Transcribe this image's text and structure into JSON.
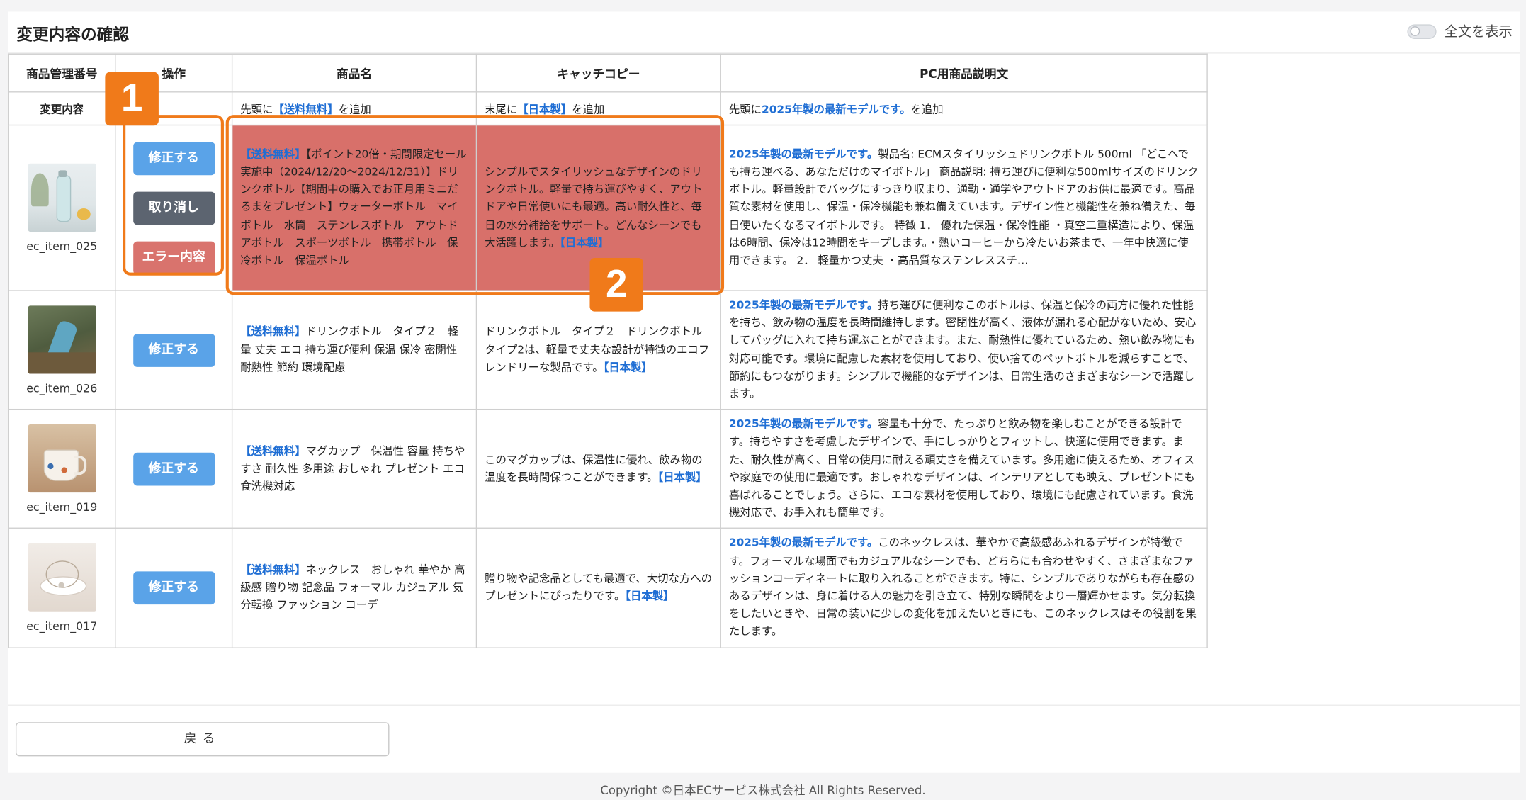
{
  "page": {
    "title": "変更内容の確認"
  },
  "toggle": {
    "label": "全文を表示"
  },
  "headers": {
    "id": "商品管理番号",
    "ops": "操作",
    "name": "商品名",
    "catch": "キャッチコピー",
    "desc": "PC用商品説明文"
  },
  "change_row": {
    "label": "変更内容",
    "name": {
      "pre": "先頭に",
      "tag": "【送料無料】",
      "post": "を追加"
    },
    "catch": {
      "pre": "末尾に",
      "tag": "【日本製】",
      "post": "を追加"
    },
    "desc": {
      "pre": "先頭に",
      "tag": "2025年製の最新モデルです。",
      "post": "を追加"
    }
  },
  "buttons": {
    "fix": "修正する",
    "cancel": "取り消し",
    "error": "エラー内容"
  },
  "rows": [
    {
      "id": "ec_item_025",
      "name_tag": "【送料無料】",
      "name_rest": "【ポイント20倍・期間限定セール実施中（2024/12/20〜2024/12/31）】ドリンクボトル【期間中の購入でお正月用ミニだるまをプレゼント】ウォーターボトル　マイボトル　水筒　ステンレスボトル　アウトドアボトル　スポーツボトル　携帯ボトル　保冷ボトル　保温ボトル",
      "catch_rest": "シンプルでスタイリッシュなデザインのドリンクボトル。軽量で持ち運びやすく、アウトドアや日常使いにも最適。高い耐久性と、毎日の水分補給をサポート。どんなシーンでも大活躍します。",
      "catch_tag": "【日本製】",
      "desc_tag": "2025年製の最新モデルです。",
      "desc_rest": "製品名: ECMスタイリッシュドリンクボトル 500ml 「どこへでも持ち運べる、あなただけのマイボトル」 商品説明: 持ち運びに便利な500mlサイズのドリンクボトル。軽量設計でバッグにすっきり収まり、通勤・通学やアウトドアのお供に最適です。高品質な素材を使用し、保温・保冷機能も兼ね備えています。デザイン性と機能性を兼ね備えた、毎日使いたくなるマイボトルです。 特徴 1． 優れた保温・保冷性能 ・真空二重構造により、保温は6時間、保冷は12時間をキープします。・熱いコーヒーから冷たいお茶まで、一年中快適に使用できます。 2． 軽量かつ丈夫 ・高品質なステンレススチ…"
    },
    {
      "id": "ec_item_026",
      "name_tag": "【送料無料】",
      "name_rest": "ドリンクボトル　タイプ２　軽量 丈夫 エコ 持ち運び便利 保温 保冷 密閉性 耐熱性 節約 環境配慮",
      "catch_rest": "ドリンクボトル　タイプ２　ドリンクボトル タイプ2は、軽量で丈夫な設計が特徴のエコフレンドリーな製品です。",
      "catch_tag": "【日本製】",
      "desc_tag": "2025年製の最新モデルです。",
      "desc_rest": "持ち運びに便利なこのボトルは、保温と保冷の両方に優れた性能を持ち、飲み物の温度を長時間維持します。密閉性が高く、液体が漏れる心配がないため、安心してバッグに入れて持ち運ぶことができます。また、耐熱性に優れているため、熱い飲み物にも対応可能です。環境に配慮した素材を使用しており、使い捨てのペットボトルを減らすことで、節約にもつながります。シンプルで機能的なデザインは、日常生活のさまざまなシーンで活躍します。"
    },
    {
      "id": "ec_item_019",
      "name_tag": "【送料無料】",
      "name_rest": "マグカップ　保温性 容量 持ちやすさ 耐久性 多用途 おしゃれ プレゼント エコ 食洗機対応",
      "catch_rest": "このマグカップは、保温性に優れ、飲み物の温度を長時間保つことができます。",
      "catch_tag": "【日本製】",
      "desc_tag": "2025年製の最新モデルです。",
      "desc_rest": "容量も十分で、たっぷりと飲み物を楽しむことができる設計です。持ちやすさを考慮したデザインで、手にしっかりとフィットし、快適に使用できます。また、耐久性が高く、日常の使用に耐える頑丈さを備えています。多用途に使えるため、オフィスや家庭での使用に最適です。おしゃれなデザインは、インテリアとしても映え、プレゼントにも喜ばれることでしょう。さらに、エコな素材を使用しており、環境にも配慮されています。食洗機対応で、お手入れも簡単です。"
    },
    {
      "id": "ec_item_017",
      "name_tag": "【送料無料】",
      "name_rest": "ネックレス　おしゃれ 華やか 高級感 贈り物 記念品 フォーマル カジュアル 気分転換 ファッション コーデ",
      "catch_rest": "贈り物や記念品としても最適で、大切な方へのプレゼントにぴったりです。",
      "catch_tag": "【日本製】",
      "desc_tag": "2025年製の最新モデルです。",
      "desc_rest": "このネックレスは、華やかで高級感あふれるデザインが特徴です。フォーマルな場面でもカジュアルなシーンでも、どちらにも合わせやすく、さまざまなファッションコーディネートに取り入れることができます。特に、シンプルでありながらも存在感のあるデザインは、身に着ける人の魅力を引き立て、特別な瞬間をより一層輝かせます。気分転換をしたいときや、日常の装いに少しの変化を加えたいときにも、このネックレスはその役割を果たします。"
    }
  ],
  "badges": {
    "one": "1",
    "two": "2"
  },
  "footer": {
    "back": "戻る",
    "copyright": "Copyright ©日本ECサービス株式会社 All Rights Reserved."
  },
  "colors": {
    "accent_orange": "#f07a1a",
    "error_red": "#d8706a",
    "link_blue": "#1f6ed4",
    "fix_blue": "#5aa3e8"
  }
}
